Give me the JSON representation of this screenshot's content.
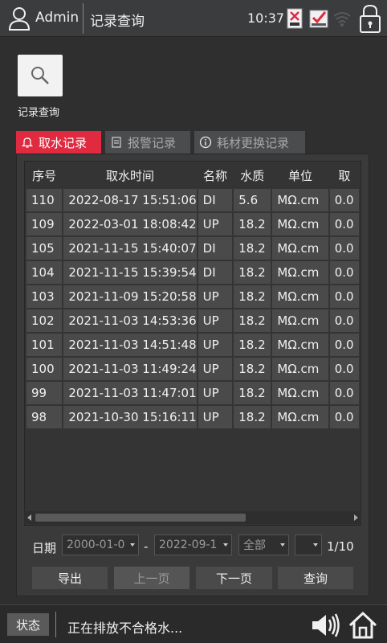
{
  "topbar": {
    "user": "Admin",
    "title": "记录查询",
    "time": "10:37"
  },
  "toolbar": {
    "search_label": "记录查询"
  },
  "tabs": [
    {
      "label": "取水记录",
      "active": true
    },
    {
      "label": "报警记录",
      "active": false
    },
    {
      "label": "耗材更换记录",
      "active": false
    }
  ],
  "table": {
    "headers": [
      "序号",
      "取水时间",
      "名称",
      "水质",
      "单位",
      "取"
    ],
    "rows": [
      [
        "110",
        "2022-08-17 15:51:06",
        "DI",
        "5.6",
        "MΩ.cm",
        "0.0"
      ],
      [
        "109",
        "2022-03-01 18:08:42",
        "UP",
        "18.2",
        "MΩ.cm",
        "0.0"
      ],
      [
        "105",
        "2021-11-15 15:40:07",
        "DI",
        "18.2",
        "MΩ.cm",
        "0.0"
      ],
      [
        "104",
        "2021-11-15 15:39:54",
        "DI",
        "18.2",
        "MΩ.cm",
        "0.0"
      ],
      [
        "103",
        "2021-11-09 15:20:58",
        "UP",
        "18.2",
        "MΩ.cm",
        "0.0"
      ],
      [
        "102",
        "2021-11-03 14:53:36",
        "UP",
        "18.2",
        "MΩ.cm",
        "0.0"
      ],
      [
        "101",
        "2021-11-03 14:51:48",
        "UP",
        "18.2",
        "MΩ.cm",
        "0.0"
      ],
      [
        "100",
        "2021-11-03 11:49:24",
        "UP",
        "18.2",
        "MΩ.cm",
        "0.0"
      ],
      [
        "99",
        "2021-11-03 11:47:01",
        "UP",
        "18.2",
        "MΩ.cm",
        "0.0"
      ],
      [
        "98",
        "2021-10-30 15:16:11",
        "UP",
        "18.2",
        "MΩ.cm",
        "0.0"
      ]
    ]
  },
  "filter": {
    "date_label": "日期",
    "start_date": "2000-01-0",
    "separator": "-",
    "end_date": "2022-09-1",
    "type": "全部",
    "page_select": "",
    "page_indicator": "1/10"
  },
  "buttons": {
    "export": "导出",
    "prev": "上一页",
    "next": "下一页",
    "query": "查询"
  },
  "status": {
    "label": "状态",
    "message": "正在排放不合格水..."
  },
  "colors": {
    "accent": "#e02a40",
    "background": "#2f2f2f"
  }
}
